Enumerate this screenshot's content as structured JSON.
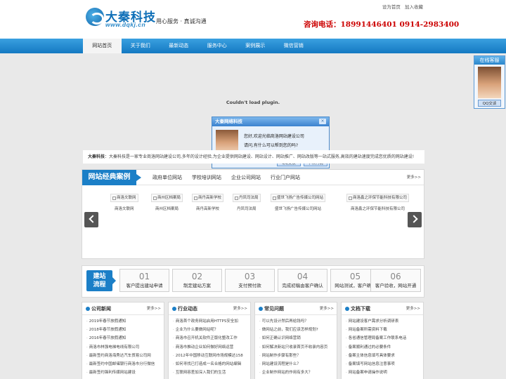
{
  "header": {
    "logo_name": "大秦科技",
    "logo_url": "www.dqkj.cn",
    "slogan": "用心服务 · 真诚沟通",
    "set_home": "设为首页",
    "add_favorite": "加入收藏",
    "hotline": "咨询电话：18991446401  0914-2983400"
  },
  "nav": {
    "items": [
      "网站首页",
      "关于我们",
      "最新动态",
      "服务中心",
      "案例展示",
      "微信营销"
    ]
  },
  "plugin_message": "Couldn't load plugin.",
  "dialog": {
    "title": "大秦网络科技",
    "close": "×",
    "message_line1": "您好,欢迎光临商洛网站建设公司",
    "message_line2": "请问,有什么可以帮到您的吗?",
    "qq_button": "QQ交谈",
    "later_button": "下次再说"
  },
  "service": {
    "title": "在线客服",
    "qq_button": "QQ交谈"
  },
  "intro": {
    "label": "大秦科技",
    "text": "：大秦科技是一家专业商洛网站建设公司,多年的设计经验,为企业提供网站建设、网站设计、网站推广、网站改版等一站式服务,高效的建站速度完成您优质的网站建设!"
  },
  "cases": {
    "title": "网站经典案例",
    "tabs": [
      "政府单位网站",
      "学校培训网站",
      "企业公司网站",
      "行业门户网站"
    ],
    "more": "更多>>",
    "items": [
      {
        "thumb": "商洛文联网",
        "name": "商洛文联网"
      },
      {
        "thumb": "商州区档案局",
        "name": "商州区档案局"
      },
      {
        "thumb": "商丹高新学校",
        "name": "商丹高新学校"
      },
      {
        "thumb": "丹凤司法局",
        "name": "丹凤司法局"
      },
      {
        "thumb": "盛世飞扬广告传媒公司网站",
        "name": "盛世飞扬广告传媒公司网站"
      },
      {
        "thumb": "商洛鑫之环保节能科技有限公司",
        "name": "商洛鑫之环保节能科技有限公司"
      }
    ]
  },
  "process": {
    "title_line1": "建站",
    "title_line2": "流程",
    "steps": [
      {
        "num": "01",
        "label": "客户提出建站申请"
      },
      {
        "num": "02",
        "label": "制定建站方案"
      },
      {
        "num": "03",
        "label": "支付预付款"
      },
      {
        "num": "04",
        "label": "完成初稿由客户确认"
      },
      {
        "num": "05",
        "label": "网站测试，客户确认"
      },
      {
        "num": "06",
        "label": "客户验收，网站开通"
      }
    ]
  },
  "columns": [
    {
      "title": "公司新闻",
      "more": "更多>>",
      "items": [
        "2019年春节放假通知",
        "2018年春节放假通知",
        "2016年春节放假通知",
        "商洛市林强电梯电线有限公司",
        "最新签约商洛海秀达汽车贸易公司网",
        "最新签约中国邮储银行商洛市分行微信",
        "最新签约锋利传媒网站建设"
      ]
    },
    {
      "title": "行业动态",
      "more": "更多>>",
      "items": [
        "商洛首个政务网站启用HTTPS安全加",
        "企业为什么要做网站呢？",
        "商洛市召开机关软件正版化整改工作",
        "商洛市推动企业如何做好网络运营",
        "2012年中国移动互联网市场规模达158",
        "如何寻找已打造成一名合格的网站编辑",
        "互联网容差加深入我们的生活"
      ]
    },
    {
      "title": "常见问题",
      "more": "更多>>",
      "items": [
        "可以先设计然后再给钱吗？",
        "做网站之前，我们应该怎样规划?",
        "如何正确认识网络营销",
        "如何解决新站只收录首页不收录内容页",
        "网站制作步骤有那些？",
        "网站建设流程是什么？",
        "企业制作网站的作用有多大？"
      ]
    },
    {
      "title": "文档下载",
      "more": "更多>>",
      "items": [
        "网站建设客户需求分析调研表",
        "网站备案所需资料下载",
        "各省通信管理局备案工作联系电话",
        "备案顺利通过的必要条件",
        "备案主体信息填写具体要求",
        "备案填写网站信息注意事项",
        "网站备案申请操作说明"
      ]
    }
  ]
}
